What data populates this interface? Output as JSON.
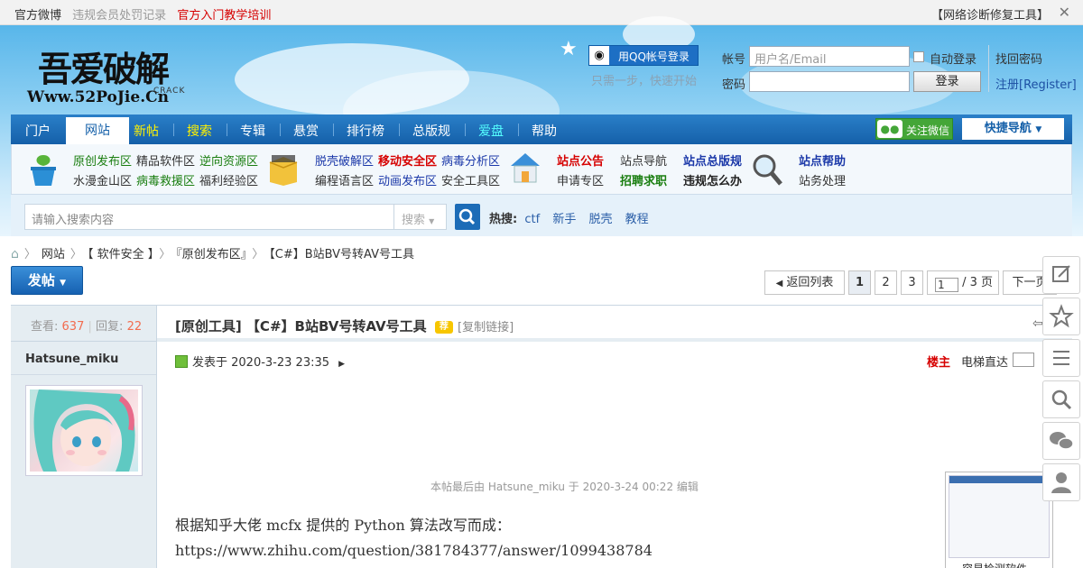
{
  "topbar": {
    "links": [
      "官方微博",
      "违规会员处罚记录",
      "官方入门教学培训"
    ],
    "link_colors": [
      "#333333",
      "#999999",
      "#d60000"
    ],
    "right": "【网络诊断修复工具】"
  },
  "logo": {
    "title": "吾爱破解",
    "url": "Www.52PoJie.Cn",
    "crack": "CRACK"
  },
  "login": {
    "qq_label": "用QQ帐号登录",
    "qq_sub": "只需一步，快速开始",
    "account_label": "帐号",
    "account_placeholder": "用户名/Email",
    "password_label": "密码",
    "auto_login": "自动登录",
    "login_button": "登录",
    "find_password": "找回密码",
    "register": "注册[Register]"
  },
  "nav": {
    "items": [
      "门户",
      "网站",
      "新帖",
      "搜索",
      "专辑",
      "悬赏",
      "排行榜",
      "总版规",
      "爱盘",
      "帮助"
    ],
    "active": "网站",
    "wechat": "关注微信",
    "quick_nav": "快捷导航"
  },
  "subnav": {
    "group1": [
      "原创发布区",
      "精品软件区",
      "逆向资源区",
      "水漫金山区",
      "病毒救援区",
      "福利经验区"
    ],
    "group2": [
      "脱壳破解区",
      "移动安全区",
      "病毒分析区",
      "编程语言区",
      "动画发布区",
      "安全工具区"
    ],
    "group3": [
      "站点公告",
      "站点导航",
      "站点总版规",
      "申请专区",
      "招聘求职",
      "违规怎么办"
    ],
    "group4": [
      "站点帮助",
      "站务处理"
    ]
  },
  "search": {
    "placeholder": "请输入搜索内容",
    "type": "搜索",
    "hot_label": "热搜:",
    "hot": [
      "ctf",
      "新手",
      "脱壳",
      "教程"
    ]
  },
  "breadcrumb": [
    "网站",
    "【 软件安全 】",
    "『原创发布区』",
    "【C#】B站BV号转AV号工具"
  ],
  "pager": {
    "post_button": "发帖",
    "back": "返回列表",
    "pages": [
      "1",
      "2",
      "3"
    ],
    "current_input": "1",
    "total": "/ 3 页",
    "next": "下一页"
  },
  "thread": {
    "views_label": "查看:",
    "views": "637",
    "replies_label": "回复:",
    "replies": "22",
    "author": "Hatsune_miku",
    "title": "[原创工具] 【C#】B站BV号转AV号工具",
    "copy_link": "[复制链接]",
    "posted": "发表于 2020-3-23 23:35",
    "owner_badge": "楼主",
    "elevator": "电梯直达",
    "edited_note": "本帖最后由 Hatsune_miku 于 2020-3-24 00:22 编辑",
    "content_line1": "根据知乎大佬 mcfx 提供的 Python 算法改写而成：",
    "content_line2": "https://www.zhihu.com/question/381784377/answer/1099438784",
    "ad_caption": "容易检测软件"
  }
}
